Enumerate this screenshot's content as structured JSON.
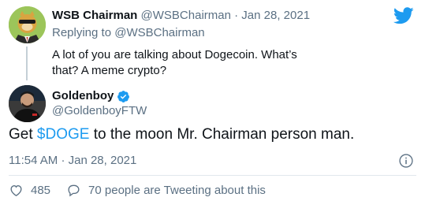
{
  "parent_tweet": {
    "author_name": "WSB Chairman",
    "author_handle": "@WSBChairman",
    "separator": "·",
    "date": "Jan 28, 2021",
    "replying_prefix": "Replying to",
    "replying_to": "@WSBChairman",
    "text": "A lot of you are talking about Dogecoin. What’s that? A meme crypto?"
  },
  "main_tweet": {
    "author_name": "Goldenboy",
    "author_handle": "@GoldenboyFTW",
    "text_before": "Get ",
    "cashtag": "$DOGE",
    "text_after": " to the moon Mr. Chairman person man.",
    "time": "11:54 AM",
    "separator": "·",
    "date": "Jan 28, 2021"
  },
  "actions": {
    "like_count": "485",
    "conversation_text": "70 people are Tweeting about this"
  },
  "colors": {
    "brand_blue": "#1d9bf0",
    "muted_text": "#5b7083",
    "primary_text": "#0f1419",
    "divider": "#e1e8ed"
  },
  "icons": {
    "brand": "twitter-bird-icon",
    "verified": "verified-badge-icon",
    "info": "info-icon",
    "like": "heart-icon",
    "conversation": "speech-bubble-icon"
  }
}
